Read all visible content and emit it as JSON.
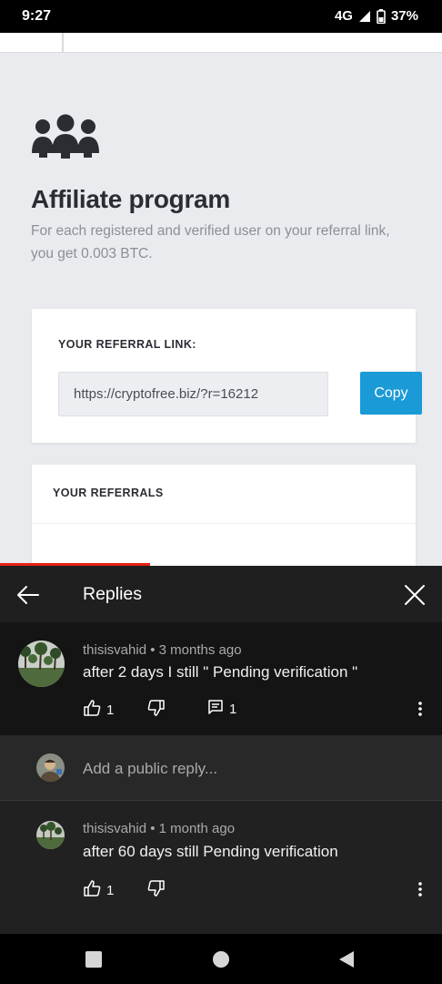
{
  "status_bar": {
    "time": "9:27",
    "network": "4G",
    "battery": "37%"
  },
  "video": {
    "title": "Affiliate program",
    "description": "For each registered and verified user on your referral link, you get 0.003 BTC.",
    "referral_label": "YOUR REFERRAL LINK:",
    "referral_url": "https://cryptofree.biz/?r=16212",
    "copy_label": "Copy",
    "referrals_title": "YOUR REFERRALS",
    "accent_color": "#1a9ad6",
    "progress": 0.34
  },
  "panel": {
    "title": "Replies",
    "comment": {
      "author": "thisisvahid",
      "time": "3 months ago",
      "separator": "•",
      "text": "after 2 days  I still \" Pending verification \"",
      "likes": "1",
      "replies": "1"
    },
    "add_reply_placeholder": "Add a public reply...",
    "reply": {
      "author": "thisisvahid",
      "time": "1 month ago",
      "separator": "•",
      "text": "after 60 days still  Pending verification",
      "likes": "1"
    }
  },
  "icons": {
    "back": "arrow-left-icon",
    "close": "close-icon",
    "like": "thumb-up-icon",
    "dislike": "thumb-down-icon",
    "reply": "comment-icon",
    "more": "more-vert-icon",
    "nav_recent": "square-icon",
    "nav_home": "circle-icon",
    "nav_back": "triangle-icon"
  }
}
